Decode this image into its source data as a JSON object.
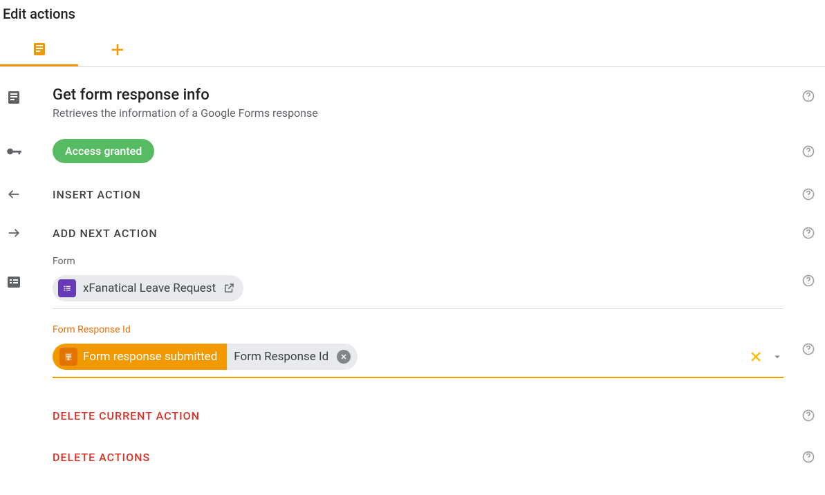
{
  "header": {
    "title": "Edit actions"
  },
  "action": {
    "title": "Get form response info",
    "desc": "Retrieves the information of a Google Forms response"
  },
  "access": {
    "label": "Access granted"
  },
  "insert": {
    "label": "INSERT ACTION"
  },
  "addNext": {
    "label": "ADD NEXT ACTION"
  },
  "formField": {
    "label": "Form",
    "chip": "xFanatical Leave Request"
  },
  "responseField": {
    "label": "Form Response Id",
    "sourceChip": "Form response submitted",
    "valueChip": "Form Response Id"
  },
  "deleteCurrent": {
    "label": "DELETE CURRENT ACTION"
  },
  "deleteActions": {
    "label": "DELETE ACTIONS"
  }
}
